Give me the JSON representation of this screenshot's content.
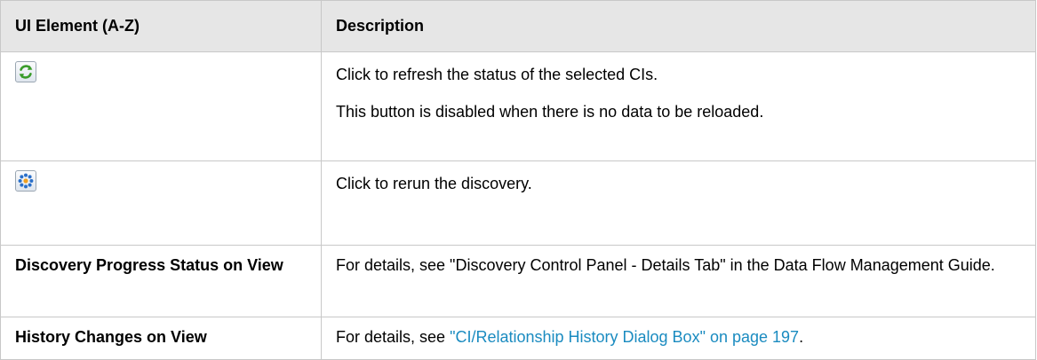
{
  "table": {
    "headers": {
      "col1": "UI Element (A-Z)",
      "col2": "Description"
    },
    "rows": [
      {
        "element_icon": "refresh-icon",
        "description": [
          "Click to refresh the status of the selected CIs.",
          "This button is disabled when there is no data to be reloaded."
        ]
      },
      {
        "element_icon": "rerun-discovery-icon",
        "description": [
          "Click to rerun the discovery."
        ]
      },
      {
        "element_label": "Discovery Progress Status on View",
        "description": [
          "For details, see \"Discovery Control Panel - Details Tab\" in the Data Flow Management Guide."
        ]
      },
      {
        "element_label": "History Changes on View",
        "description_prefix": "For details, see ",
        "description_link": "\"CI/Relationship History Dialog Box\" on page 197",
        "description_suffix": "."
      }
    ]
  },
  "colors": {
    "header_bg": "#e6e6e6",
    "border": "#c8c8c8",
    "link": "#1a8bc0",
    "refresh_icon_green": "#3a9c2b",
    "rerun_icon_blue": "#2a6fc9"
  }
}
